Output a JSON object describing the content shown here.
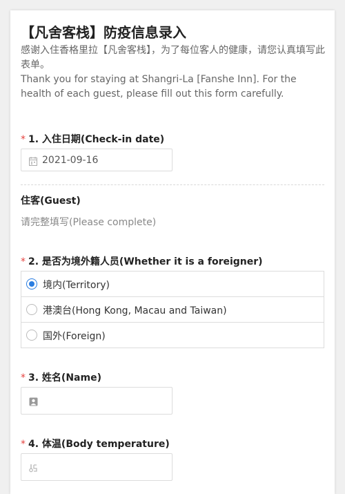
{
  "form": {
    "title": "【凡舍客栈】防疫信息录入",
    "description_cn": "感谢入住香格里拉【凡舍客栈】，为了每位客人的健康，请您认真填写此表单。",
    "description_en": "Thank you for staying at Shangri-La [Fanshe Inn]. For the health of each guest, please fill out this form carefully."
  },
  "q1": {
    "required_mark": "*",
    "label": "1. 入住日期(Check-in date)",
    "value": "2021-09-16",
    "icon": "calendar-icon"
  },
  "guest_section": {
    "title": "住客(Guest)",
    "subtitle": "请完整填写(Please complete)"
  },
  "q2": {
    "required_mark": "*",
    "label": "2. 是否为境外籍人员(Whether it is a foreigner)",
    "options": [
      {
        "label": "境内(Territory)",
        "checked": true
      },
      {
        "label": "港澳台(Hong Kong, Macau and Taiwan)",
        "checked": false
      },
      {
        "label": "国外(Foreign)",
        "checked": false
      }
    ],
    "accent_color": "#2a7de1"
  },
  "q3": {
    "required_mark": "*",
    "label": "3. 姓名(Name)",
    "value": "",
    "icon": "person-card-icon"
  },
  "q4": {
    "required_mark": "*",
    "label": "4. 体温(Body temperature)",
    "value": "",
    "icon": "thermometer-icon"
  },
  "colors": {
    "required": "#e64340",
    "background": "#f0f0f0"
  }
}
